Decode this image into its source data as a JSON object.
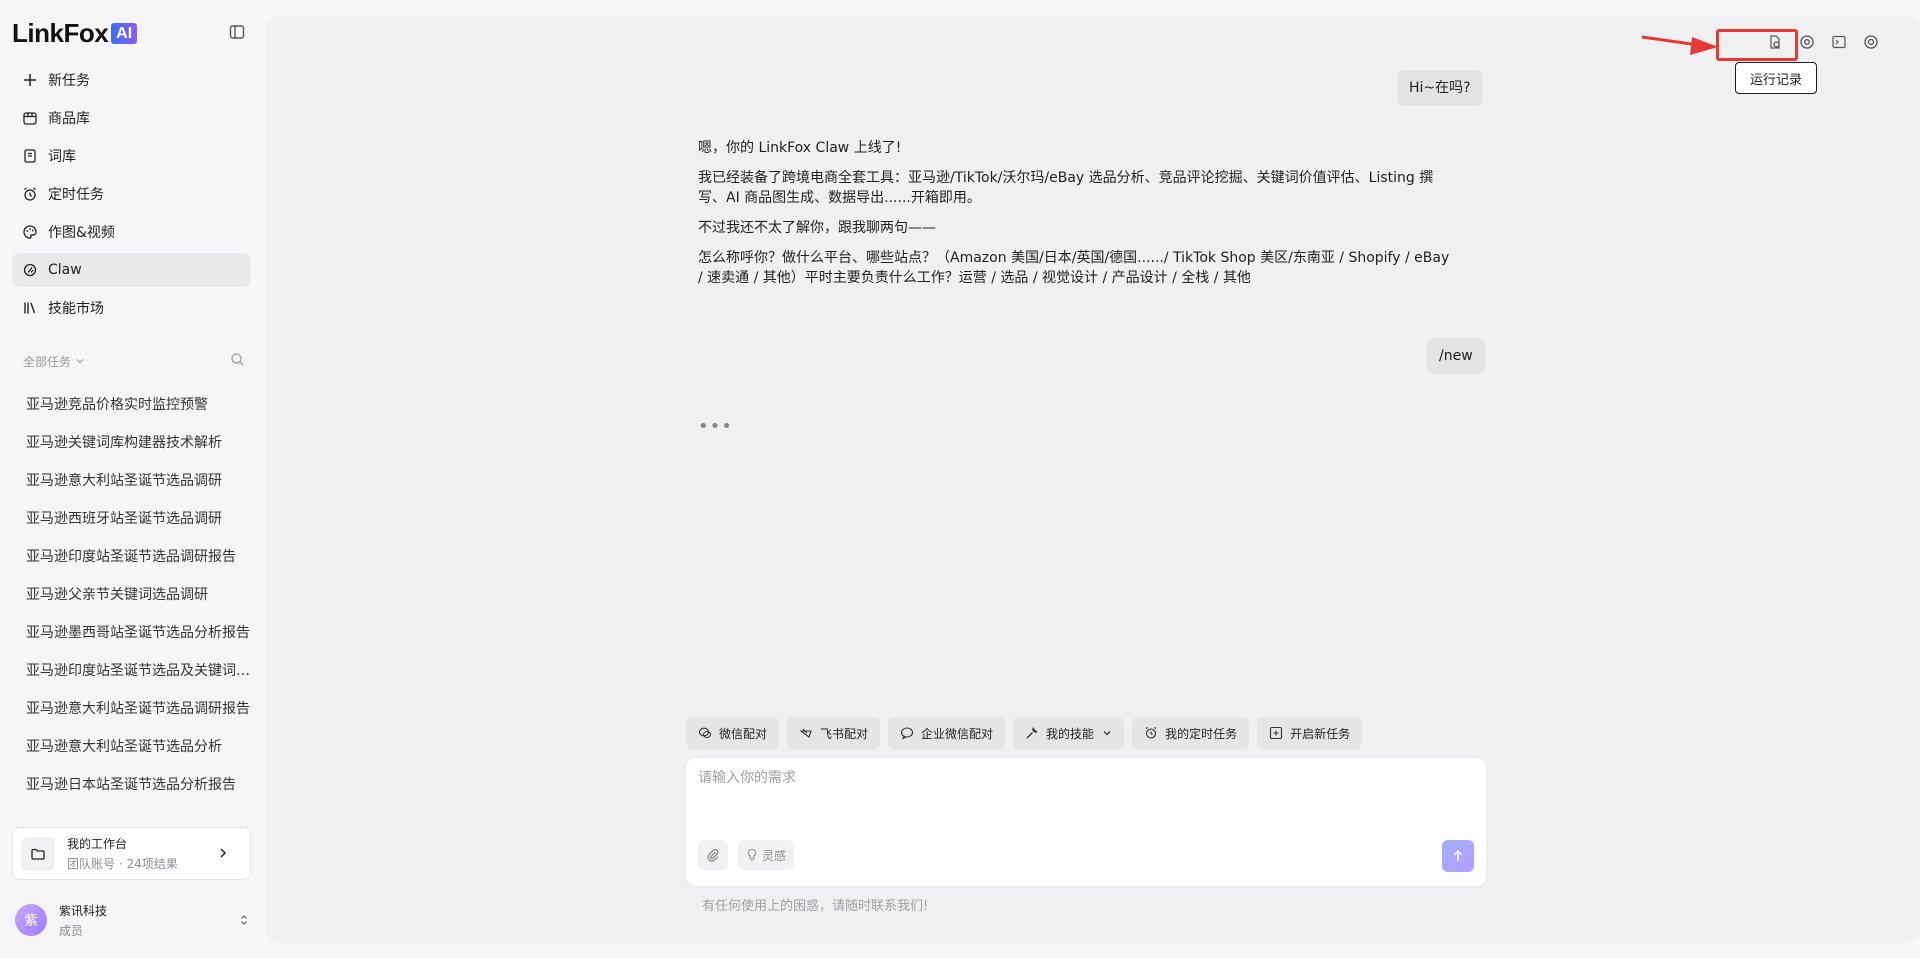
{
  "brand": {
    "logo_text": "LinkFox",
    "logo_badge": "AI"
  },
  "nav": [
    {
      "label": "新任务",
      "icon": "plus-icon"
    },
    {
      "label": "商品库",
      "icon": "box-icon"
    },
    {
      "label": "词库",
      "icon": "book-icon"
    },
    {
      "label": "定时任务",
      "icon": "alarm-clock-icon"
    },
    {
      "label": "作图&视频",
      "icon": "palette-icon"
    },
    {
      "label": "Claw",
      "icon": "claw-icon",
      "active": true
    },
    {
      "label": "技能市场",
      "icon": "library-icon"
    }
  ],
  "tasks": {
    "filter_label": "全部任务",
    "items": [
      "亚马逊竞品价格实时监控预警",
      "亚马逊关键词库构建器技术解析",
      "亚马逊意大利站圣诞节选品调研",
      "亚马逊西班牙站圣诞节选品调研",
      "亚马逊印度站圣诞节选品调研报告",
      "亚马逊父亲节关键词选品调研",
      "亚马逊墨西哥站圣诞节选品分析报告",
      "亚马逊印度站圣诞节选品及关键词分析",
      "亚马逊意大利站圣诞节选品调研报告",
      "亚马逊意大利站圣诞节选品分析",
      "亚马逊日本站圣诞节选品分析报告"
    ]
  },
  "workspace": {
    "title": "我的工作台",
    "subtitle": "团队账号 · 24项结果"
  },
  "user": {
    "avatar_char": "紫",
    "name": "紫讯科技",
    "role": "成员"
  },
  "topbar": {
    "tooltip": "运行记录",
    "highlight_color": "#e53935"
  },
  "chat": {
    "user_msg_1": "Hi~在吗?",
    "assistant": [
      "嗯，你的 LinkFox Claw 上线了!",
      "我已经装备了跨境电商全套工具：亚马逊/TikTok/沃尔玛/eBay 选品分析、竞品评论挖掘、关键词价值评估、Listing 撰写、AI 商品图生成、数据导出......开箱即用。",
      "不过我还不太了解你，跟我聊两句——",
      "怎么称呼你？做什么平台、哪些站点？（Amazon 美国/日本/英国/德国....../ TikTok Shop 美区/东南亚 / Shopify / eBay / 速卖通 / 其他）平时主要负责什么工作？运营 / 选品 / 视觉设计 / 产品设计 / 全栈 / 其他"
    ],
    "user_msg_2": "/new",
    "typing": "•••"
  },
  "quick_actions": [
    {
      "label": "微信配对",
      "icon": "wechat-icon"
    },
    {
      "label": "飞书配对",
      "icon": "feishu-icon"
    },
    {
      "label": "企业微信配对",
      "icon": "wecom-icon"
    },
    {
      "label": "我的技能",
      "icon": "wrench-icon",
      "dropdown": true
    },
    {
      "label": "我的定时任务",
      "icon": "alarm-clock-icon"
    },
    {
      "label": "开启新任务",
      "icon": "plus-square-icon"
    }
  ],
  "composer": {
    "placeholder": "请输入你的需求",
    "inspiration_label": "灵感"
  },
  "help_text": "有任何使用上的困惑，请随时联系我们!"
}
